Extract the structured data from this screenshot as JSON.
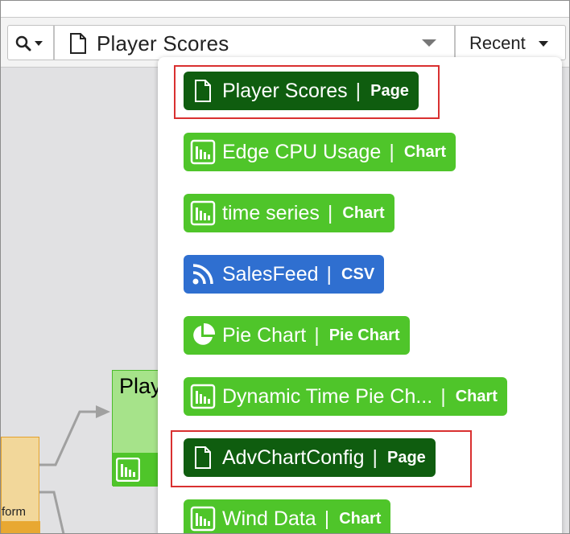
{
  "toolbar": {
    "page_title": "Player Scores",
    "recent_label": "Recent",
    "search_icon": "search-icon",
    "page_icon": "page-icon"
  },
  "canvas": {
    "green_node_label": "Play",
    "orange_node_label": "form"
  },
  "recent_items": [
    {
      "name": "Player Scores",
      "type": "Page",
      "icon": "page-icon",
      "highlighted": true
    },
    {
      "name": "Edge CPU Usage",
      "type": "Chart",
      "icon": "bar-chart-icon",
      "highlighted": false
    },
    {
      "name": "time series",
      "type": "Chart",
      "icon": "bar-chart-icon",
      "highlighted": false
    },
    {
      "name": "SalesFeed",
      "type": "CSV",
      "icon": "rss-feed-icon",
      "highlighted": false
    },
    {
      "name": "Pie Chart",
      "type": "Pie Chart",
      "icon": "pie-chart-icon",
      "highlighted": false
    },
    {
      "name": "Dynamic Time Pie Ch...",
      "type": "Chart",
      "icon": "bar-chart-icon",
      "highlighted": false
    },
    {
      "name": "AdvChartConfig",
      "type": "Page",
      "icon": "page-icon",
      "highlighted": true
    },
    {
      "name": "Wind Data",
      "type": "Chart",
      "icon": "bar-chart-icon",
      "highlighted": false
    }
  ],
  "colors": {
    "page_chip": "#0f5d0f",
    "chart_chip": "#4fc52a",
    "csv_chip": "#2f6fd0",
    "highlight": "#d93030"
  }
}
